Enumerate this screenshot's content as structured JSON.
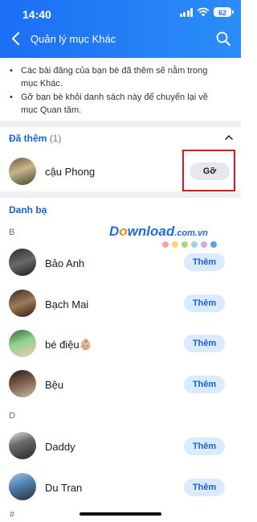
{
  "status": {
    "time": "14:40",
    "battery": "62"
  },
  "header": {
    "title": "Quản lý mục Khác"
  },
  "info": {
    "bullet": "•",
    "line1": "Các bài đăng của bạn bè đã thêm sẽ nằm trong mục Khác.",
    "line2": "Gỡ bạn bè khỏi danh sách này để chuyển lại về mục Quan tâm."
  },
  "added": {
    "title": "Đã thêm",
    "count": "(1)",
    "items": [
      {
        "name": "cậu Phong",
        "action": "Gỡ"
      }
    ]
  },
  "contacts": {
    "title": "Danh bạ",
    "groups": [
      {
        "letter": "B",
        "items": [
          {
            "name": "Bảo Anh",
            "action": "Thêm"
          },
          {
            "name": "Bạch Mai",
            "action": "Thêm"
          },
          {
            "name": "bé điệu👶🏼",
            "action": "Thêm"
          },
          {
            "name": "Bệu",
            "action": "Thêm"
          }
        ]
      },
      {
        "letter": "D",
        "items": [
          {
            "name": "Daddy",
            "action": "Thêm"
          },
          {
            "name": "Du Tran",
            "action": "Thêm"
          }
        ]
      },
      {
        "letter": "#",
        "items": []
      }
    ]
  },
  "watermark": {
    "brand_a": "D",
    "brand_o": "o",
    "brand_b": "wnload",
    "suffix": ".com.vn"
  },
  "colors": {
    "header": "#1b6ff5",
    "accent": "#1464d8",
    "highlight": "#e8141c",
    "button_bg": "#dbeafe"
  },
  "icons": {
    "back": "chevron-left-icon",
    "search": "search-icon",
    "collapse": "chevron-up-icon"
  }
}
